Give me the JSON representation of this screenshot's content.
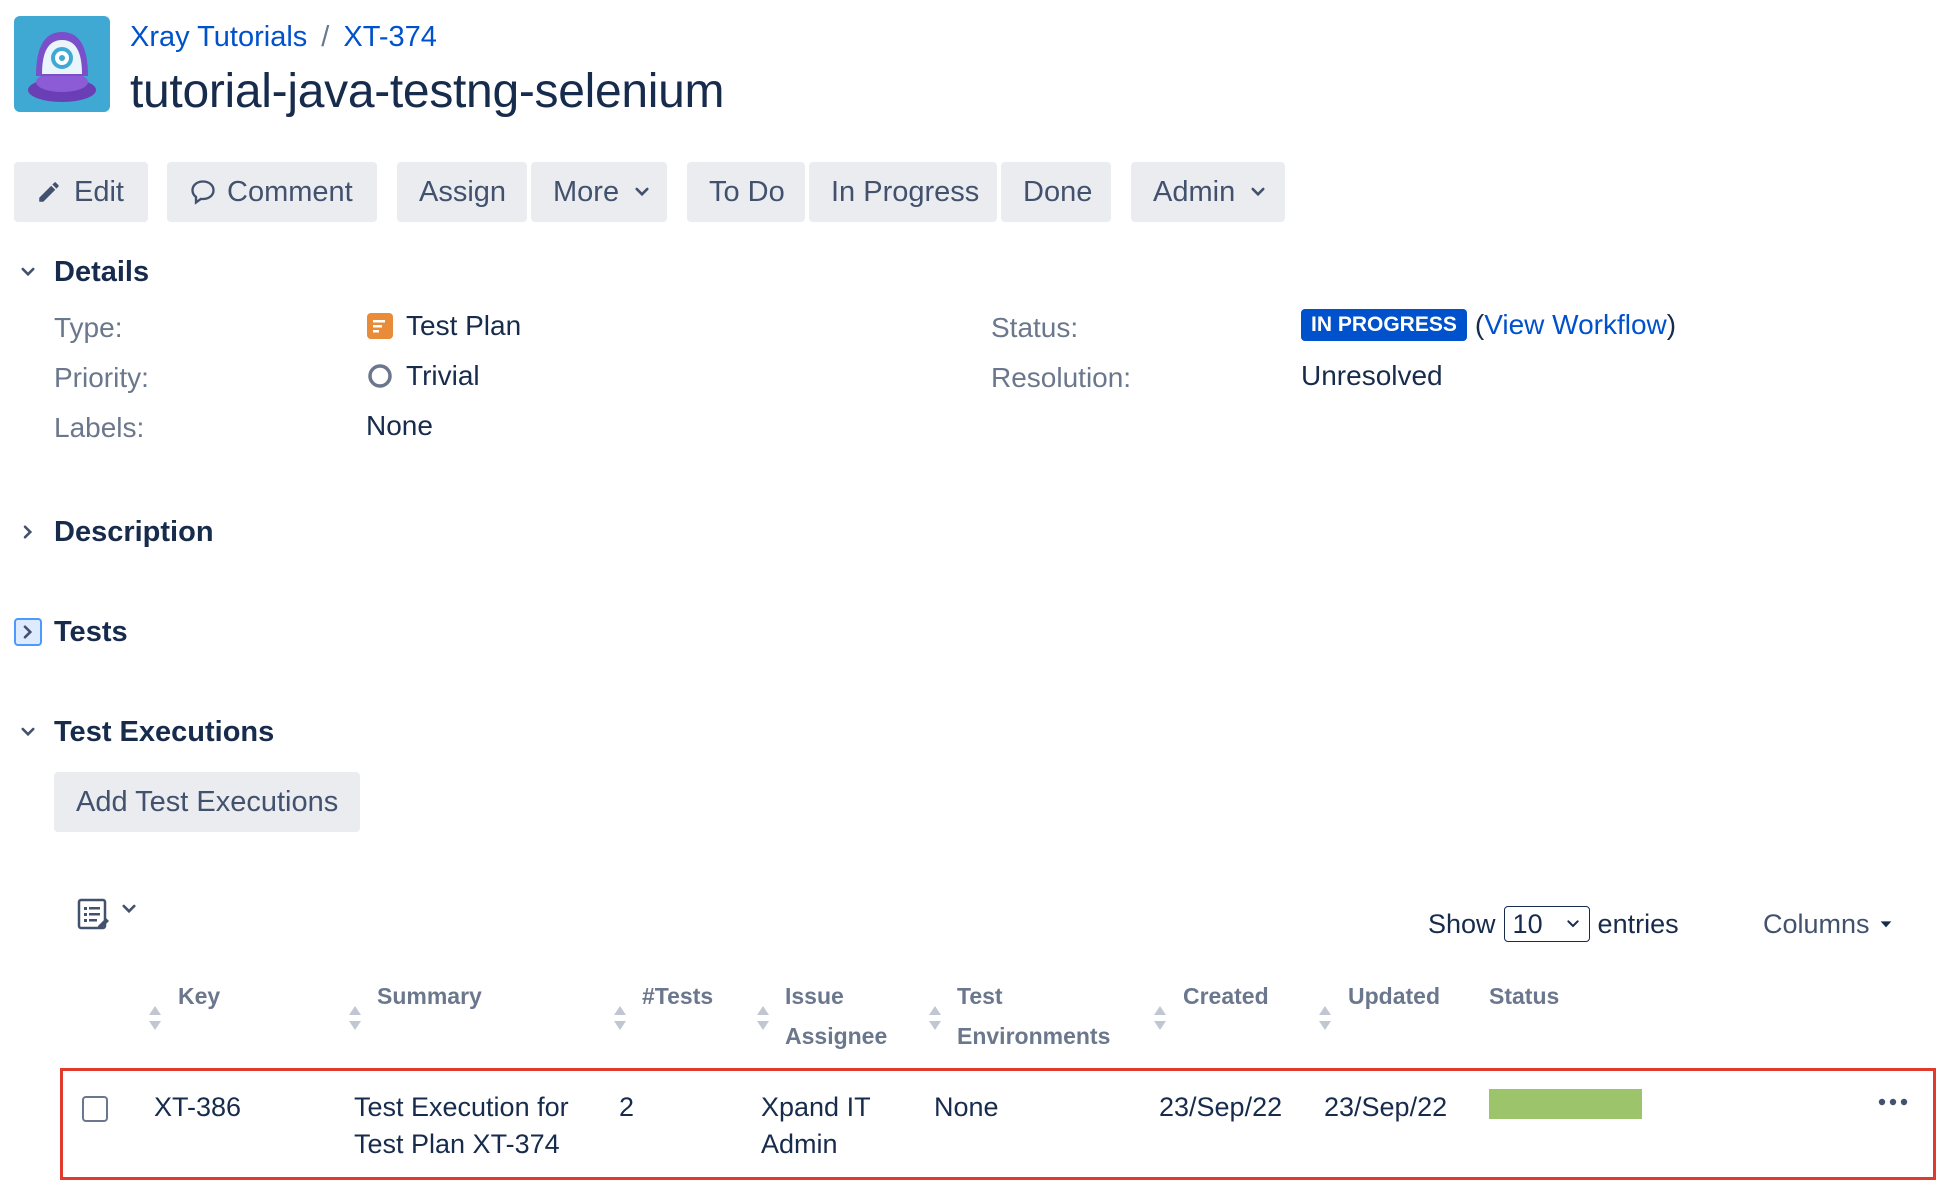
{
  "breadcrumb": {
    "project": "Xray Tutorials",
    "issue_key": "XT-374"
  },
  "issue_title": "tutorial-java-testng-selenium",
  "toolbar": {
    "edit": "Edit",
    "comment": "Comment",
    "assign": "Assign",
    "more": "More",
    "todo": "To Do",
    "in_progress": "In Progress",
    "done": "Done",
    "admin": "Admin"
  },
  "details": {
    "heading": "Details",
    "type_label": "Type:",
    "type_value": "Test Plan",
    "priority_label": "Priority:",
    "priority_value": "Trivial",
    "labels_label": "Labels:",
    "labels_value": "None",
    "status_label": "Status:",
    "status_value": "IN PROGRESS",
    "view_workflow": "View Workflow",
    "paren_open": "(",
    "paren_close": ")",
    "resolution_label": "Resolution:",
    "resolution_value": "Unresolved"
  },
  "sections": {
    "description": "Description",
    "tests": "Tests",
    "test_executions": "Test Executions"
  },
  "test_executions": {
    "add_button": "Add Test Executions",
    "show_label": "Show",
    "entries_value": "10",
    "entries_label": "entries",
    "columns_label": "Columns",
    "headers": {
      "key": "Key",
      "summary": "Summary",
      "tests": "#Tests",
      "assignee_1": "Issue",
      "assignee_2": "Assignee",
      "env_1": "Test",
      "env_2": "Environments",
      "created": "Created",
      "updated": "Updated",
      "status": "Status"
    },
    "rows": [
      {
        "key": "XT-386",
        "summary_1": "Test Execution for",
        "summary_2": "Test Plan XT-374",
        "tests": "2",
        "assignee_1": "Xpand IT",
        "assignee_2": "Admin",
        "environments": "None",
        "created": "23/Sep/22",
        "updated": "23/Sep/22",
        "status_progress": 1.0
      }
    ]
  },
  "colors": {
    "accent": "#0052cc",
    "status_bar": "#9bc46b",
    "highlight": "#e03a2f"
  },
  "icons": [
    "avatar-icon",
    "pencil-icon",
    "comment-icon",
    "chevron-down-icon",
    "test-plan-icon",
    "trivial-priority-icon",
    "chevron-right-icon",
    "list-view-icon",
    "sort-icon",
    "more-icon"
  ]
}
